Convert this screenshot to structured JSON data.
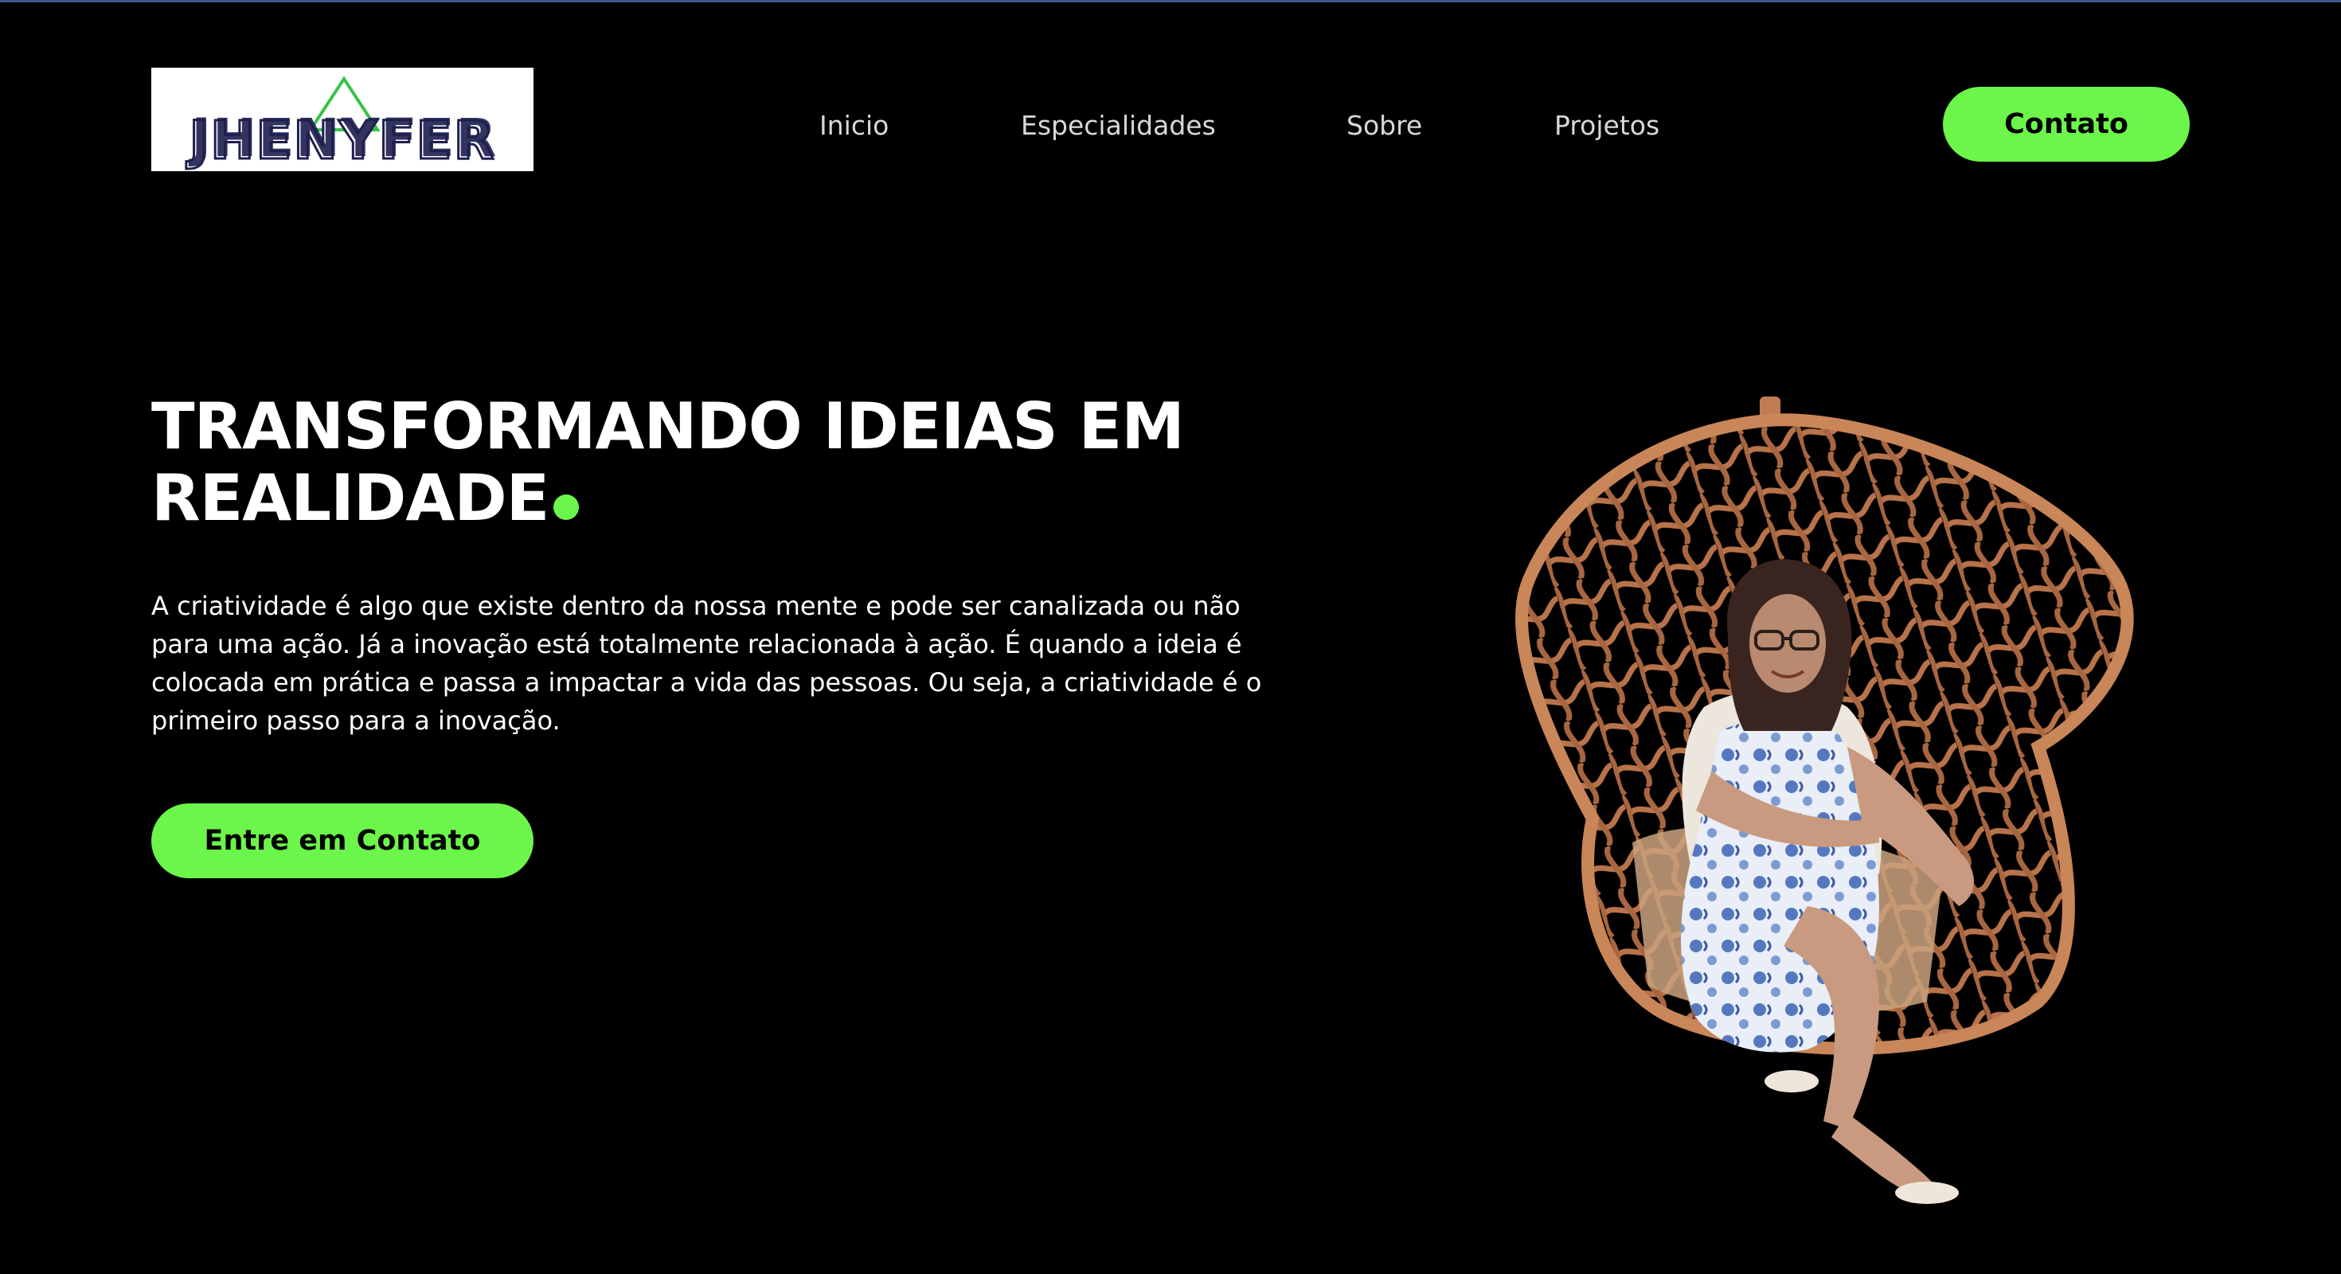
{
  "header": {
    "logo_text": "JHENYFER",
    "nav": [
      {
        "label": "Inicio"
      },
      {
        "label": "Especialidades"
      },
      {
        "label": "Sobre"
      },
      {
        "label": "Projetos"
      }
    ],
    "cta_label": "Contato"
  },
  "hero": {
    "title_line1": "TRANSFORMANDO IDEIAS EM",
    "title_line2": "REALIDADE",
    "text": "A criatividade é algo que existe dentro da nossa mente e pode ser canalizada ou não para uma ação. Já a inovação está totalmente relacionada à ação. É quando a ideia é colocada em prática e passa a impactar a vida das pessoas. Ou seja, a criatividade é o primeiro passo para a inovação.",
    "cta_label": "Entre em Contato"
  },
  "colors": {
    "background": "#000000",
    "accent": "#6cf54a",
    "text": "#ffffff",
    "nav_text": "#d8d8d8"
  },
  "icons": [
    "logo-triangle-icon",
    "accent-dot-icon"
  ]
}
